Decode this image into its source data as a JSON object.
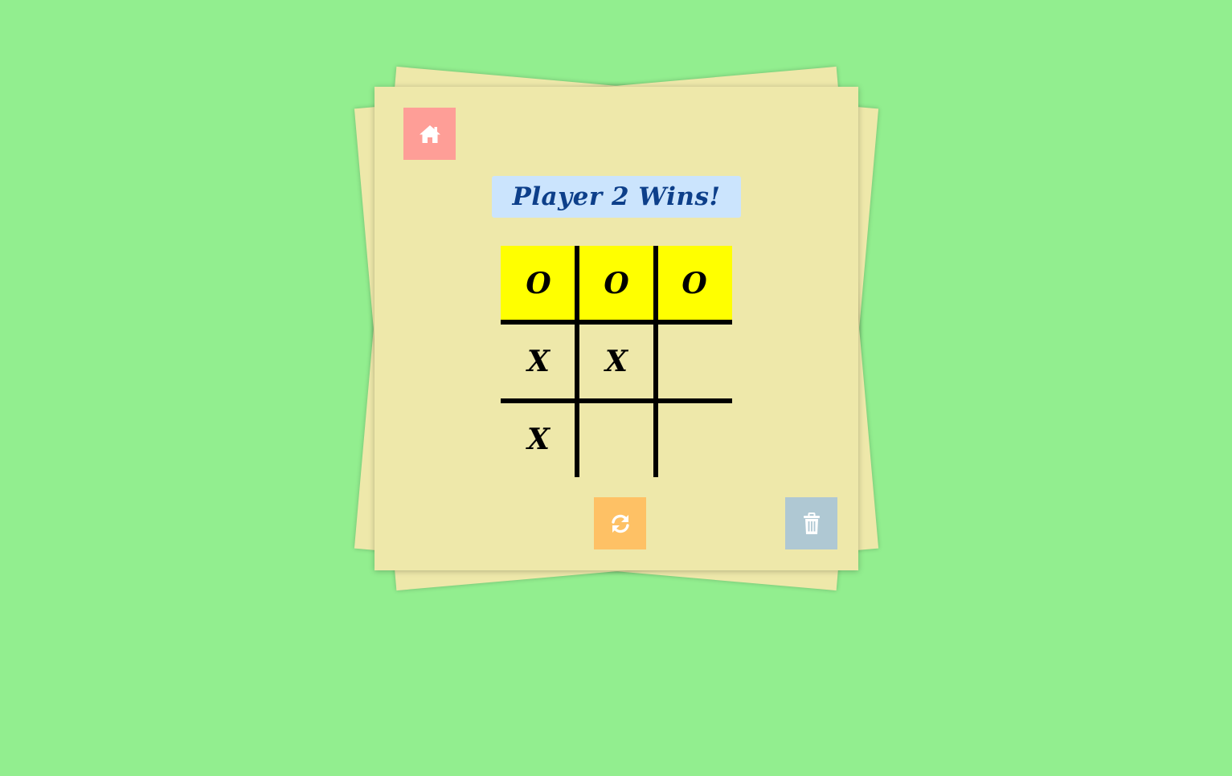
{
  "status": {
    "message": "Player 2 Wins!"
  },
  "board": {
    "cells": [
      "O",
      "O",
      "O",
      "X",
      "X",
      "",
      "X",
      "",
      ""
    ],
    "winning_cells": [
      0,
      1,
      2
    ]
  },
  "buttons": {
    "home": {
      "icon": "home-icon"
    },
    "reset": {
      "icon": "refresh-icon"
    },
    "clear": {
      "icon": "trash-icon"
    }
  },
  "colors": {
    "background": "#92ee8f",
    "paper": "#eee8aa",
    "home_button": "#fe9e97",
    "reset_button": "#fec165",
    "clear_button": "#afc8d3",
    "status_background": "#cbe4fd",
    "status_text": "#0d3f8a",
    "winning_cell": "#ffff00"
  }
}
